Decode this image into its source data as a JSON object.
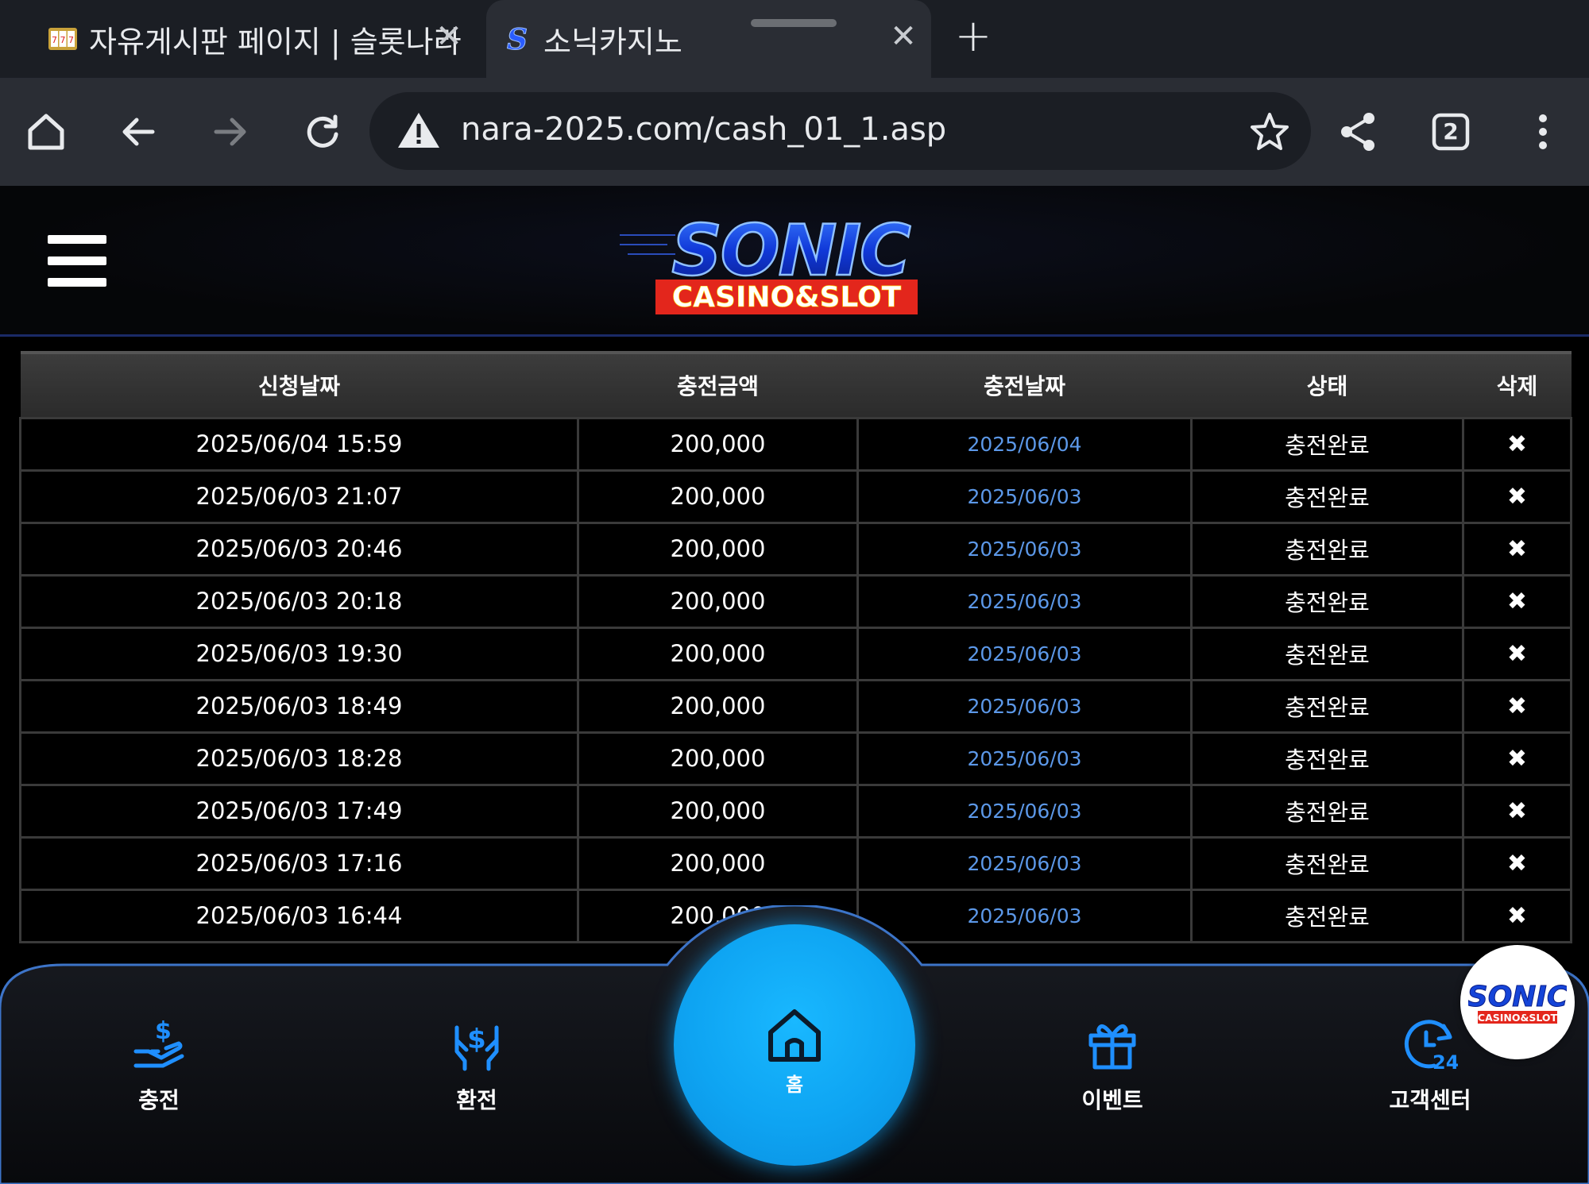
{
  "browser": {
    "tabs": [
      {
        "title": "자유게시판 페이지 | 슬롯나라",
        "favicon": "slot-machine-icon",
        "active": false
      },
      {
        "title": "소닉카지노",
        "favicon": "sonic-s-icon",
        "active": true
      }
    ],
    "url": "nara-2025.com/cash_01_1.asp",
    "tab_count": "2"
  },
  "header": {
    "logo_title": "SONIC",
    "logo_subtitle": "CASINO&SLOT"
  },
  "table": {
    "headers": [
      "신청날짜",
      "충전금액",
      "충전날짜",
      "상태",
      "삭제"
    ],
    "rows": [
      {
        "requested": "2025/06/04 15:59",
        "amount": "200,000",
        "charged": "2025/06/04",
        "status": "충전완료",
        "delete": "✖"
      },
      {
        "requested": "2025/06/03 21:07",
        "amount": "200,000",
        "charged": "2025/06/03",
        "status": "충전완료",
        "delete": "✖"
      },
      {
        "requested": "2025/06/03 20:46",
        "amount": "200,000",
        "charged": "2025/06/03",
        "status": "충전완료",
        "delete": "✖"
      },
      {
        "requested": "2025/06/03 20:18",
        "amount": "200,000",
        "charged": "2025/06/03",
        "status": "충전완료",
        "delete": "✖"
      },
      {
        "requested": "2025/06/03 19:30",
        "amount": "200,000",
        "charged": "2025/06/03",
        "status": "충전완료",
        "delete": "✖"
      },
      {
        "requested": "2025/06/03 18:49",
        "amount": "200,000",
        "charged": "2025/06/03",
        "status": "충전완료",
        "delete": "✖"
      },
      {
        "requested": "2025/06/03 18:28",
        "amount": "200,000",
        "charged": "2025/06/03",
        "status": "충전완료",
        "delete": "✖"
      },
      {
        "requested": "2025/06/03 17:49",
        "amount": "200,000",
        "charged": "2025/06/03",
        "status": "충전완료",
        "delete": "✖"
      },
      {
        "requested": "2025/06/03 17:16",
        "amount": "200,000",
        "charged": "2025/06/03",
        "status": "충전완료",
        "delete": "✖"
      },
      {
        "requested": "2025/06/03 16:44",
        "amount": "200,000",
        "charged": "2025/06/03",
        "status": "충전완료",
        "delete": "✖"
      }
    ]
  },
  "bottom_nav": {
    "charge": "충전",
    "exchange": "환전",
    "home": "홈",
    "event": "이벤트",
    "support": "고객센터"
  },
  "colors": {
    "accent_blue": "#0ea4f2",
    "link_blue": "#5c98e8",
    "logo_red": "#e3261c",
    "icon_blue": "#1f8fff"
  }
}
